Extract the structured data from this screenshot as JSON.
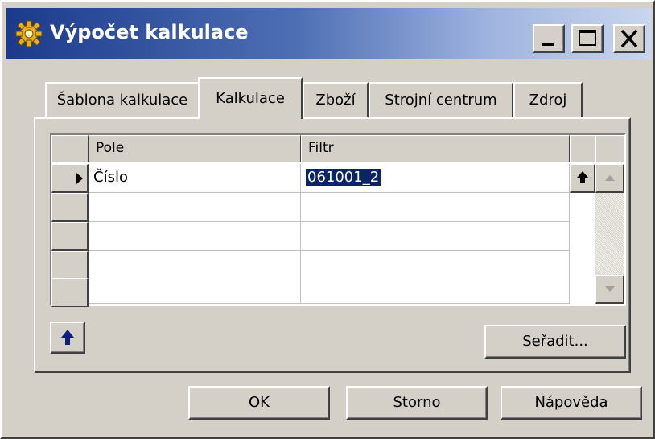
{
  "window": {
    "title": "Výpočet kalkulace",
    "icon": "gear-icon"
  },
  "title_buttons": {
    "minimize": "minimize-icon",
    "maximize": "maximize-icon",
    "close": "close-icon"
  },
  "tabs": [
    {
      "label": "Šablona kalkulace",
      "active": false
    },
    {
      "label": "Kalkulace",
      "active": true
    },
    {
      "label": "Zboží",
      "active": false
    },
    {
      "label": "Strojní centrum",
      "active": false
    },
    {
      "label": "Zdroj",
      "active": false
    }
  ],
  "grid": {
    "columns": [
      "Pole",
      "Filtr"
    ],
    "rows": [
      {
        "pole": "Číslo",
        "filtr": "061001_2",
        "current": true
      },
      {
        "pole": "",
        "filtr": ""
      },
      {
        "pole": "",
        "filtr": ""
      },
      {
        "pole": "",
        "filtr": ""
      },
      {
        "pole": "",
        "filtr": ""
      }
    ]
  },
  "panel_buttons": {
    "sort_label": "Seřadit..."
  },
  "footer": {
    "ok_label": "OK",
    "cancel_label": "Storno",
    "help_label": "Nápověda"
  },
  "colors": {
    "selection": "#0a246a",
    "face": "#d4d0c8",
    "title_dark": "#1c3a8c"
  }
}
